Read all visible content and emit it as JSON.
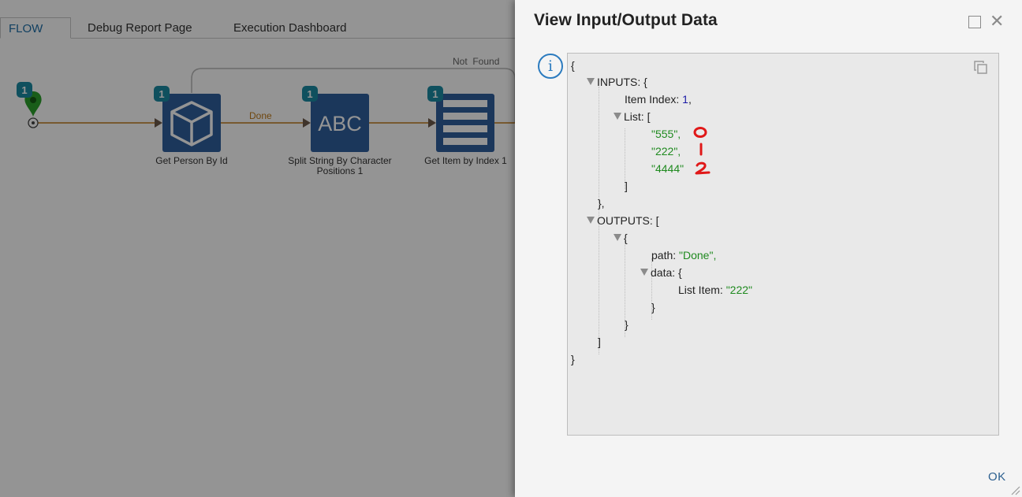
{
  "tabs": [
    {
      "label": "FLOW",
      "active": true
    },
    {
      "label": "Debug Report Page",
      "active": false
    },
    {
      "label": "Execution Dashboard",
      "active": false
    }
  ],
  "flow": {
    "steps": [
      {
        "name": "Get Person By Id",
        "badge": "1",
        "icon": "cube-icon"
      },
      {
        "name": "Split String By Character Positions 1",
        "badge": "1",
        "icon": "abc-text-icon",
        "icon_text": "ABC"
      },
      {
        "name": "Get Item by Index 1",
        "badge": "1",
        "icon": "list-icon"
      }
    ],
    "start_badge": "1",
    "edge_labels": {
      "done": "Done",
      "not_found": "Not  Found"
    },
    "colors": {
      "step_blue": "#2f5f9e",
      "badge_teal": "#1a8ba3",
      "edge_orange": "#c07a1a",
      "start_green": "#2ca02c"
    }
  },
  "dialog": {
    "title": "View Input/Output Data",
    "ok_label": "OK",
    "json_view": {
      "open_brace": "{",
      "inputs_key": "INPUTS: {",
      "item_index_key": "Item Index: ",
      "item_index_value": "1",
      "list_key": "List: [",
      "list_values": [
        "\"555\",",
        "\"222\",",
        "\"4444\""
      ],
      "list_close": "]",
      "inputs_close": "},",
      "outputs_key": "OUTPUTS: [",
      "output_obj_open": "{",
      "path_key": "path: ",
      "path_value": "\"Done\",",
      "data_key": "data: {",
      "list_item_key": "List Item: ",
      "list_item_value": "\"222\"",
      "data_close": "}",
      "output_obj_close": "}",
      "outputs_close": "]",
      "close_brace": "}"
    },
    "annotations": [
      "0",
      "1",
      "2"
    ]
  }
}
